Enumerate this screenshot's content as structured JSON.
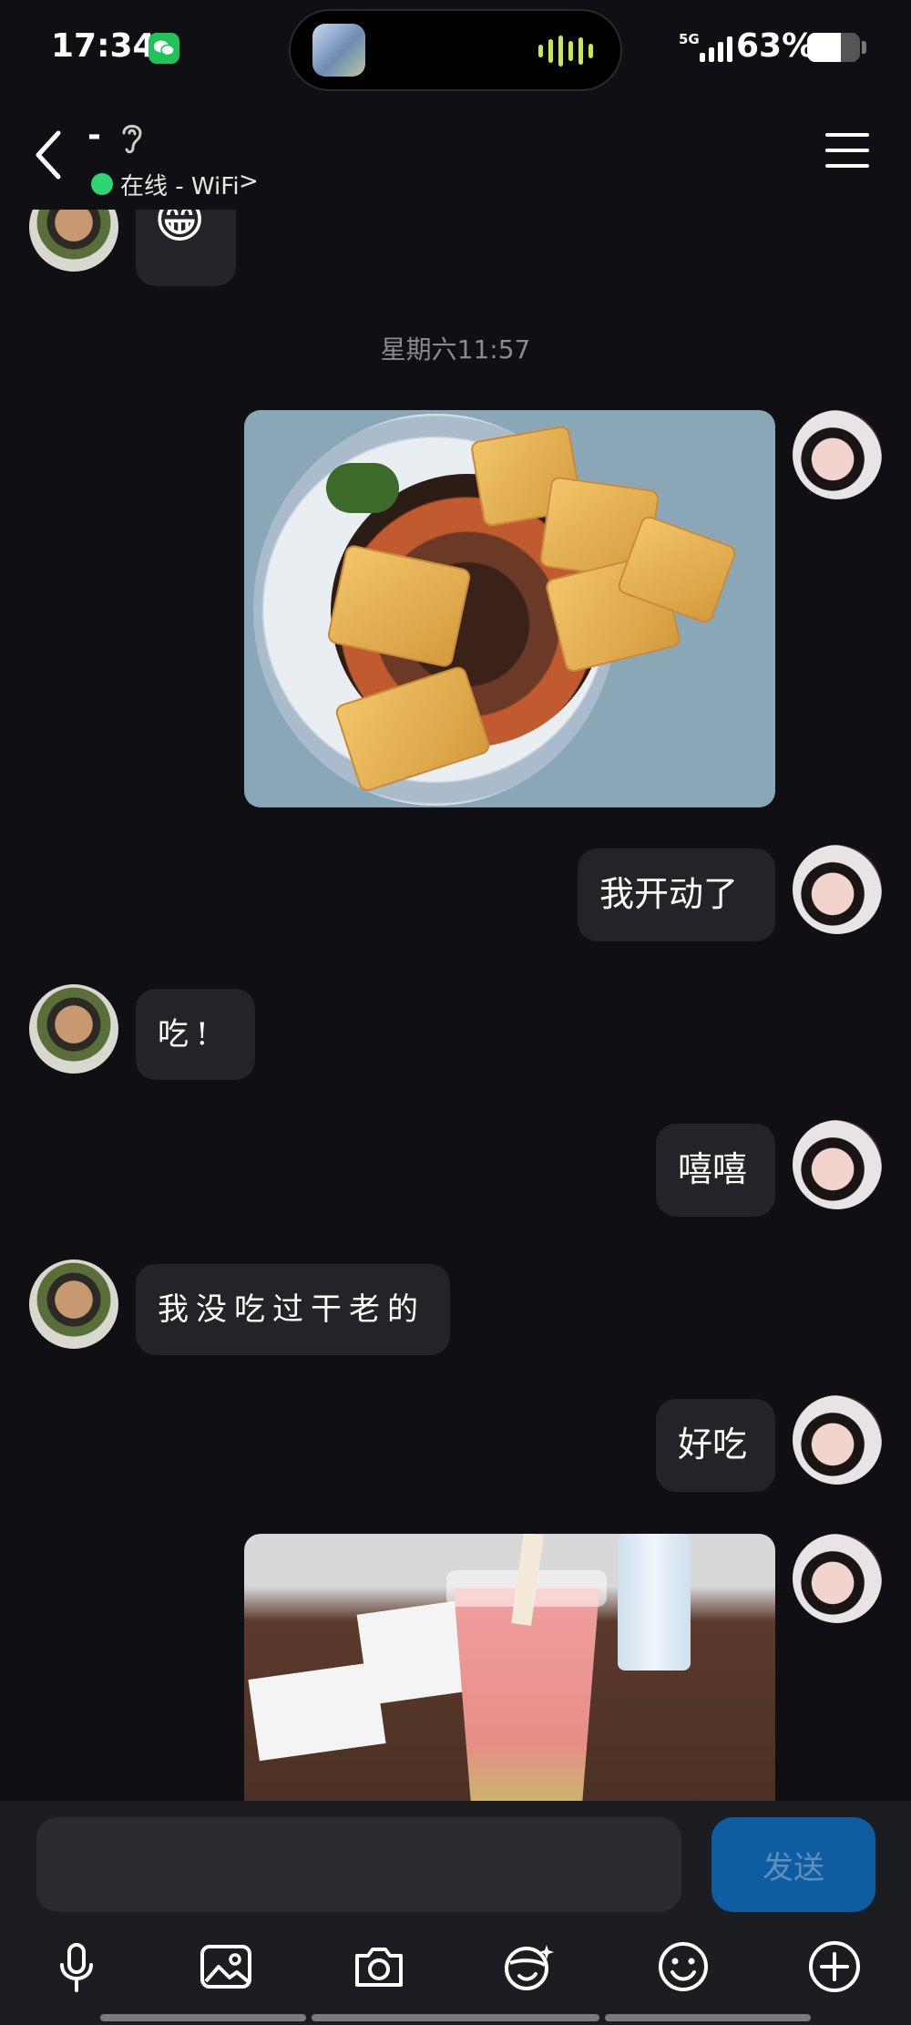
{
  "status_bar": {
    "time": "17:34",
    "network": "5G",
    "battery_percent": "63%",
    "battery_level": 0.63
  },
  "header": {
    "contact_name": "-",
    "presence": "在线 - WiFi",
    "presence_chevron": ">"
  },
  "chat": {
    "timestamp": "星期六11:57",
    "messages": [
      {
        "side": "left",
        "type": "emoji",
        "text": "😁"
      },
      {
        "side": "right",
        "type": "image",
        "content": "noodle-bowl-photo"
      },
      {
        "side": "right",
        "type": "text",
        "text": "我开动了"
      },
      {
        "side": "left",
        "type": "text",
        "text": "吃!"
      },
      {
        "side": "right",
        "type": "text",
        "text": "嘻嘻"
      },
      {
        "side": "left",
        "type": "text",
        "text": "我没吃过干老的"
      },
      {
        "side": "right",
        "type": "text",
        "text": "好吃"
      },
      {
        "side": "right",
        "type": "image",
        "content": "bubble-tea-photo"
      }
    ]
  },
  "input": {
    "placeholder": "",
    "send_label": "发送"
  },
  "toolbar": [
    "microphone-icon",
    "image-icon",
    "camera-icon",
    "sticker-icon",
    "emoji-icon",
    "plus-icon"
  ]
}
